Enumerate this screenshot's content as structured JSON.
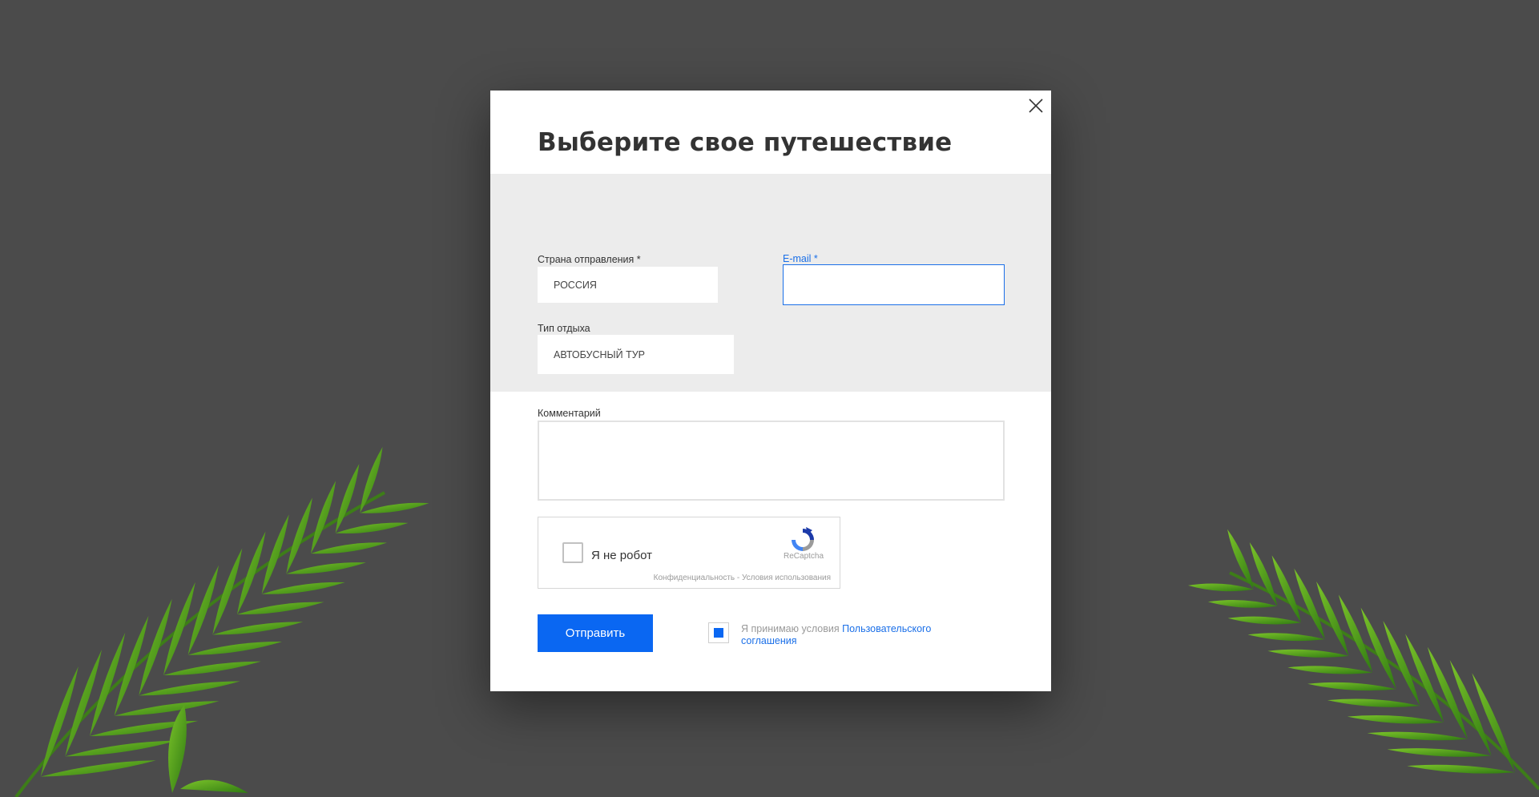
{
  "modal": {
    "title": "Выберите свое путешествие"
  },
  "form": {
    "country": {
      "label": "Страна отправления *",
      "value": "РОССИЯ"
    },
    "email": {
      "label": "E-mail *",
      "value": ""
    },
    "rest_type": {
      "label": "Тип отдыха",
      "value": "АВТОБУСНЫЙ ТУР"
    },
    "comment": {
      "label": "Комментарий",
      "value": ""
    }
  },
  "captcha": {
    "label": "Я не робот",
    "brand": "ReCaptcha",
    "links": "Конфиденциальность - Условия использования"
  },
  "submit": {
    "label": "Отправить"
  },
  "agreement": {
    "checked": true,
    "text": "Я принимаю условия",
    "link": "Пользовательского соглашения"
  },
  "colors": {
    "background": "#4b4b4b",
    "accent": "#0a67f2",
    "band": "#ececec"
  },
  "icons": [
    "close-icon",
    "recaptcha-icon",
    "palm-leaf-decoration"
  ]
}
